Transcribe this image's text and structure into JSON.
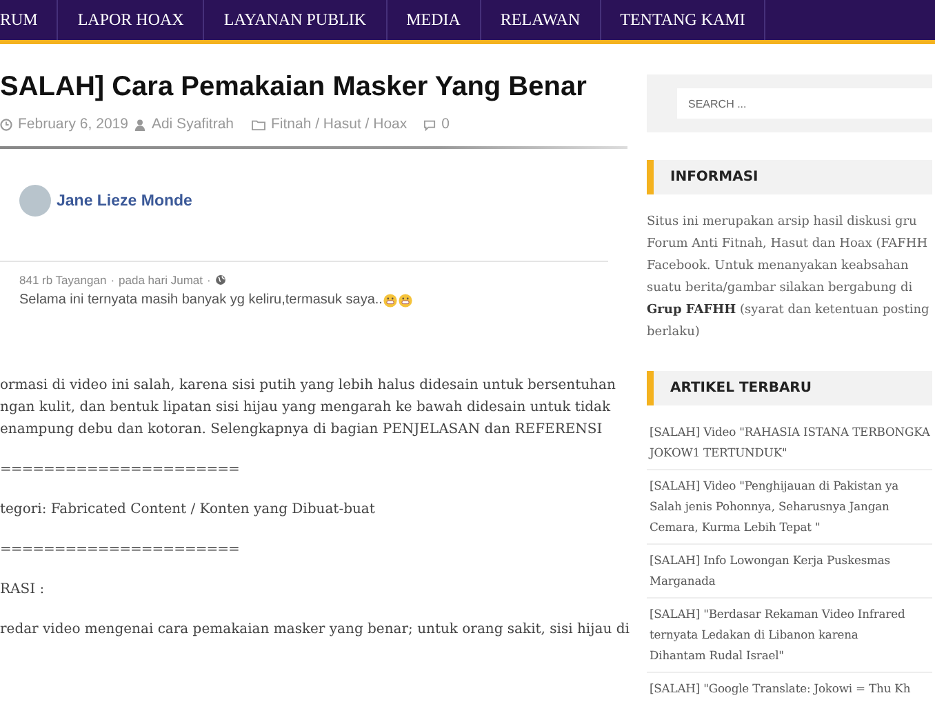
{
  "nav": [
    {
      "label": "RUM",
      "selected": false
    },
    {
      "label": "LAPOR HOAX",
      "selected": false
    },
    {
      "label": "LAYANAN PUBLIK",
      "selected": false
    },
    {
      "label": "MEDIA",
      "selected": false
    },
    {
      "label": "RELAWAN",
      "selected": false
    },
    {
      "label": "TENTANG KAMI",
      "selected": false
    }
  ],
  "article": {
    "title": "SALAH] Cara Pemakaian Masker Yang Benar",
    "meta": {
      "date": "February 6, 2019",
      "author": "Adi Syafitrah",
      "category": "Fitnah / Hasut / Hoax",
      "comments": "0"
    },
    "embed": {
      "name": "Jane Lieze Monde",
      "views": "841 rb Tayangan",
      "when": "pada hari Jumat",
      "sep": "·",
      "text": "Selama ini ternyata masih banyak yg keliru,termasuk saya.."
    },
    "blocks": [
      {
        "kind": "para",
        "lines": [
          "ormasi di video ini salah, karena sisi putih yang lebih halus didesain untuk bersentuhan",
          "ngan kulit, dan bentuk lipatan sisi hijau yang mengarah ke bawah didesain untuk tidak",
          "enampung debu dan kotoran. Selengkapnya di bagian PENJELASAN dan REFERENSI"
        ]
      },
      {
        "kind": "rule",
        "lines": [
          "======================"
        ]
      },
      {
        "kind": "para",
        "lines": [
          "tegori: Fabricated Content / Konten yang Dibuat-buat"
        ]
      },
      {
        "kind": "rule",
        "lines": [
          "======================"
        ]
      },
      {
        "kind": "para",
        "lines": [
          "RASI :"
        ]
      },
      {
        "kind": "para",
        "lines": [
          "redar video mengenai cara pemakaian masker yang benar; untuk orang sakit, sisi hijau di"
        ]
      }
    ]
  },
  "sidebar": {
    "search": {
      "placeholder": "SEARCH ..."
    },
    "info": {
      "title": "INFORMASI",
      "lines": [
        "Situs ini merupakan arsip hasil diskusi gru",
        "Forum Anti Fitnah, Hasut dan Hoax (FAFHH",
        "Facebook. Untuk menanyakan keabsahan",
        "suatu berita/gambar silakan bergabung di",
        "**Grup FAFHH** (syarat dan ketentuan posting",
        "berlaku)"
      ]
    },
    "recent": {
      "title": "ARTIKEL TERBARU",
      "items": [
        [
          "[SALAH] Video \"RAHASIA ISTANA TERBONGKA",
          "JOKOW1 TERTUNDUK\""
        ],
        [
          "[SALAH] Video \"Penghijauan di Pakistan ya",
          "Salah jenis Pohonnya, Seharusnya Jangan",
          "Cemara, Kurma Lebih Tepat \""
        ],
        [
          "[SALAH] Info Lowongan Kerja Puskesmas",
          "Marganada"
        ],
        [
          "[SALAH] \"Berdasar Rekaman Video Infrared",
          "ternyata Ledakan di Libanon karena",
          "Dihantam Rudal Israel\""
        ],
        [
          "[SALAH] \"Google Translate: Jokowi = Thu Kh"
        ]
      ]
    }
  }
}
